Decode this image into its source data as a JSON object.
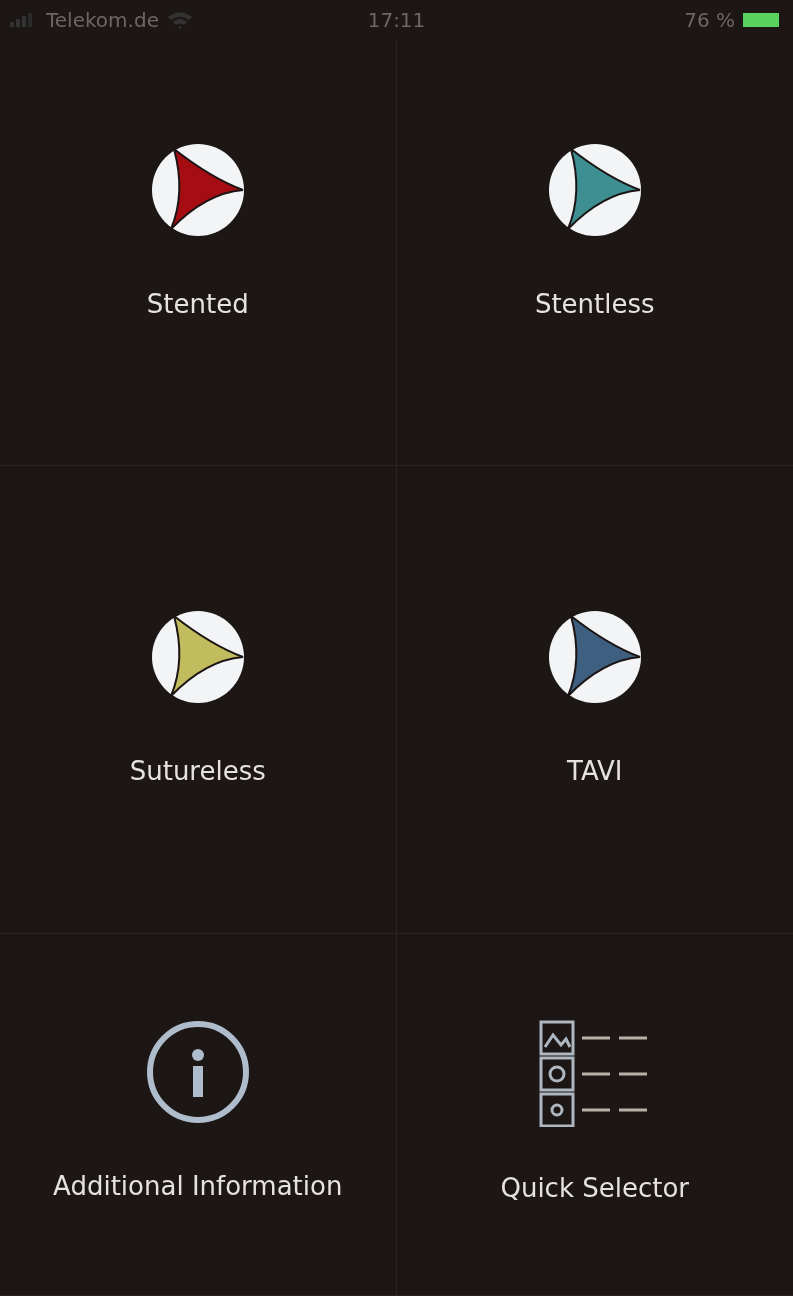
{
  "status_bar": {
    "carrier": "Telekom.de",
    "time": "17:11",
    "battery": "76 %"
  },
  "tiles": [
    {
      "kind": "valve",
      "label": "Stented",
      "color": "#a50d12"
    },
    {
      "kind": "valve",
      "label": "Stentless",
      "color": "#3e8f92"
    },
    {
      "kind": "valve",
      "label": "Sutureless",
      "color": "#c1bd5e"
    },
    {
      "kind": "valve",
      "label": "TAVI",
      "color": "#3f5f80"
    },
    {
      "kind": "info",
      "label": "Additional Information"
    },
    {
      "kind": "selector",
      "label": "Quick Selector"
    }
  ]
}
